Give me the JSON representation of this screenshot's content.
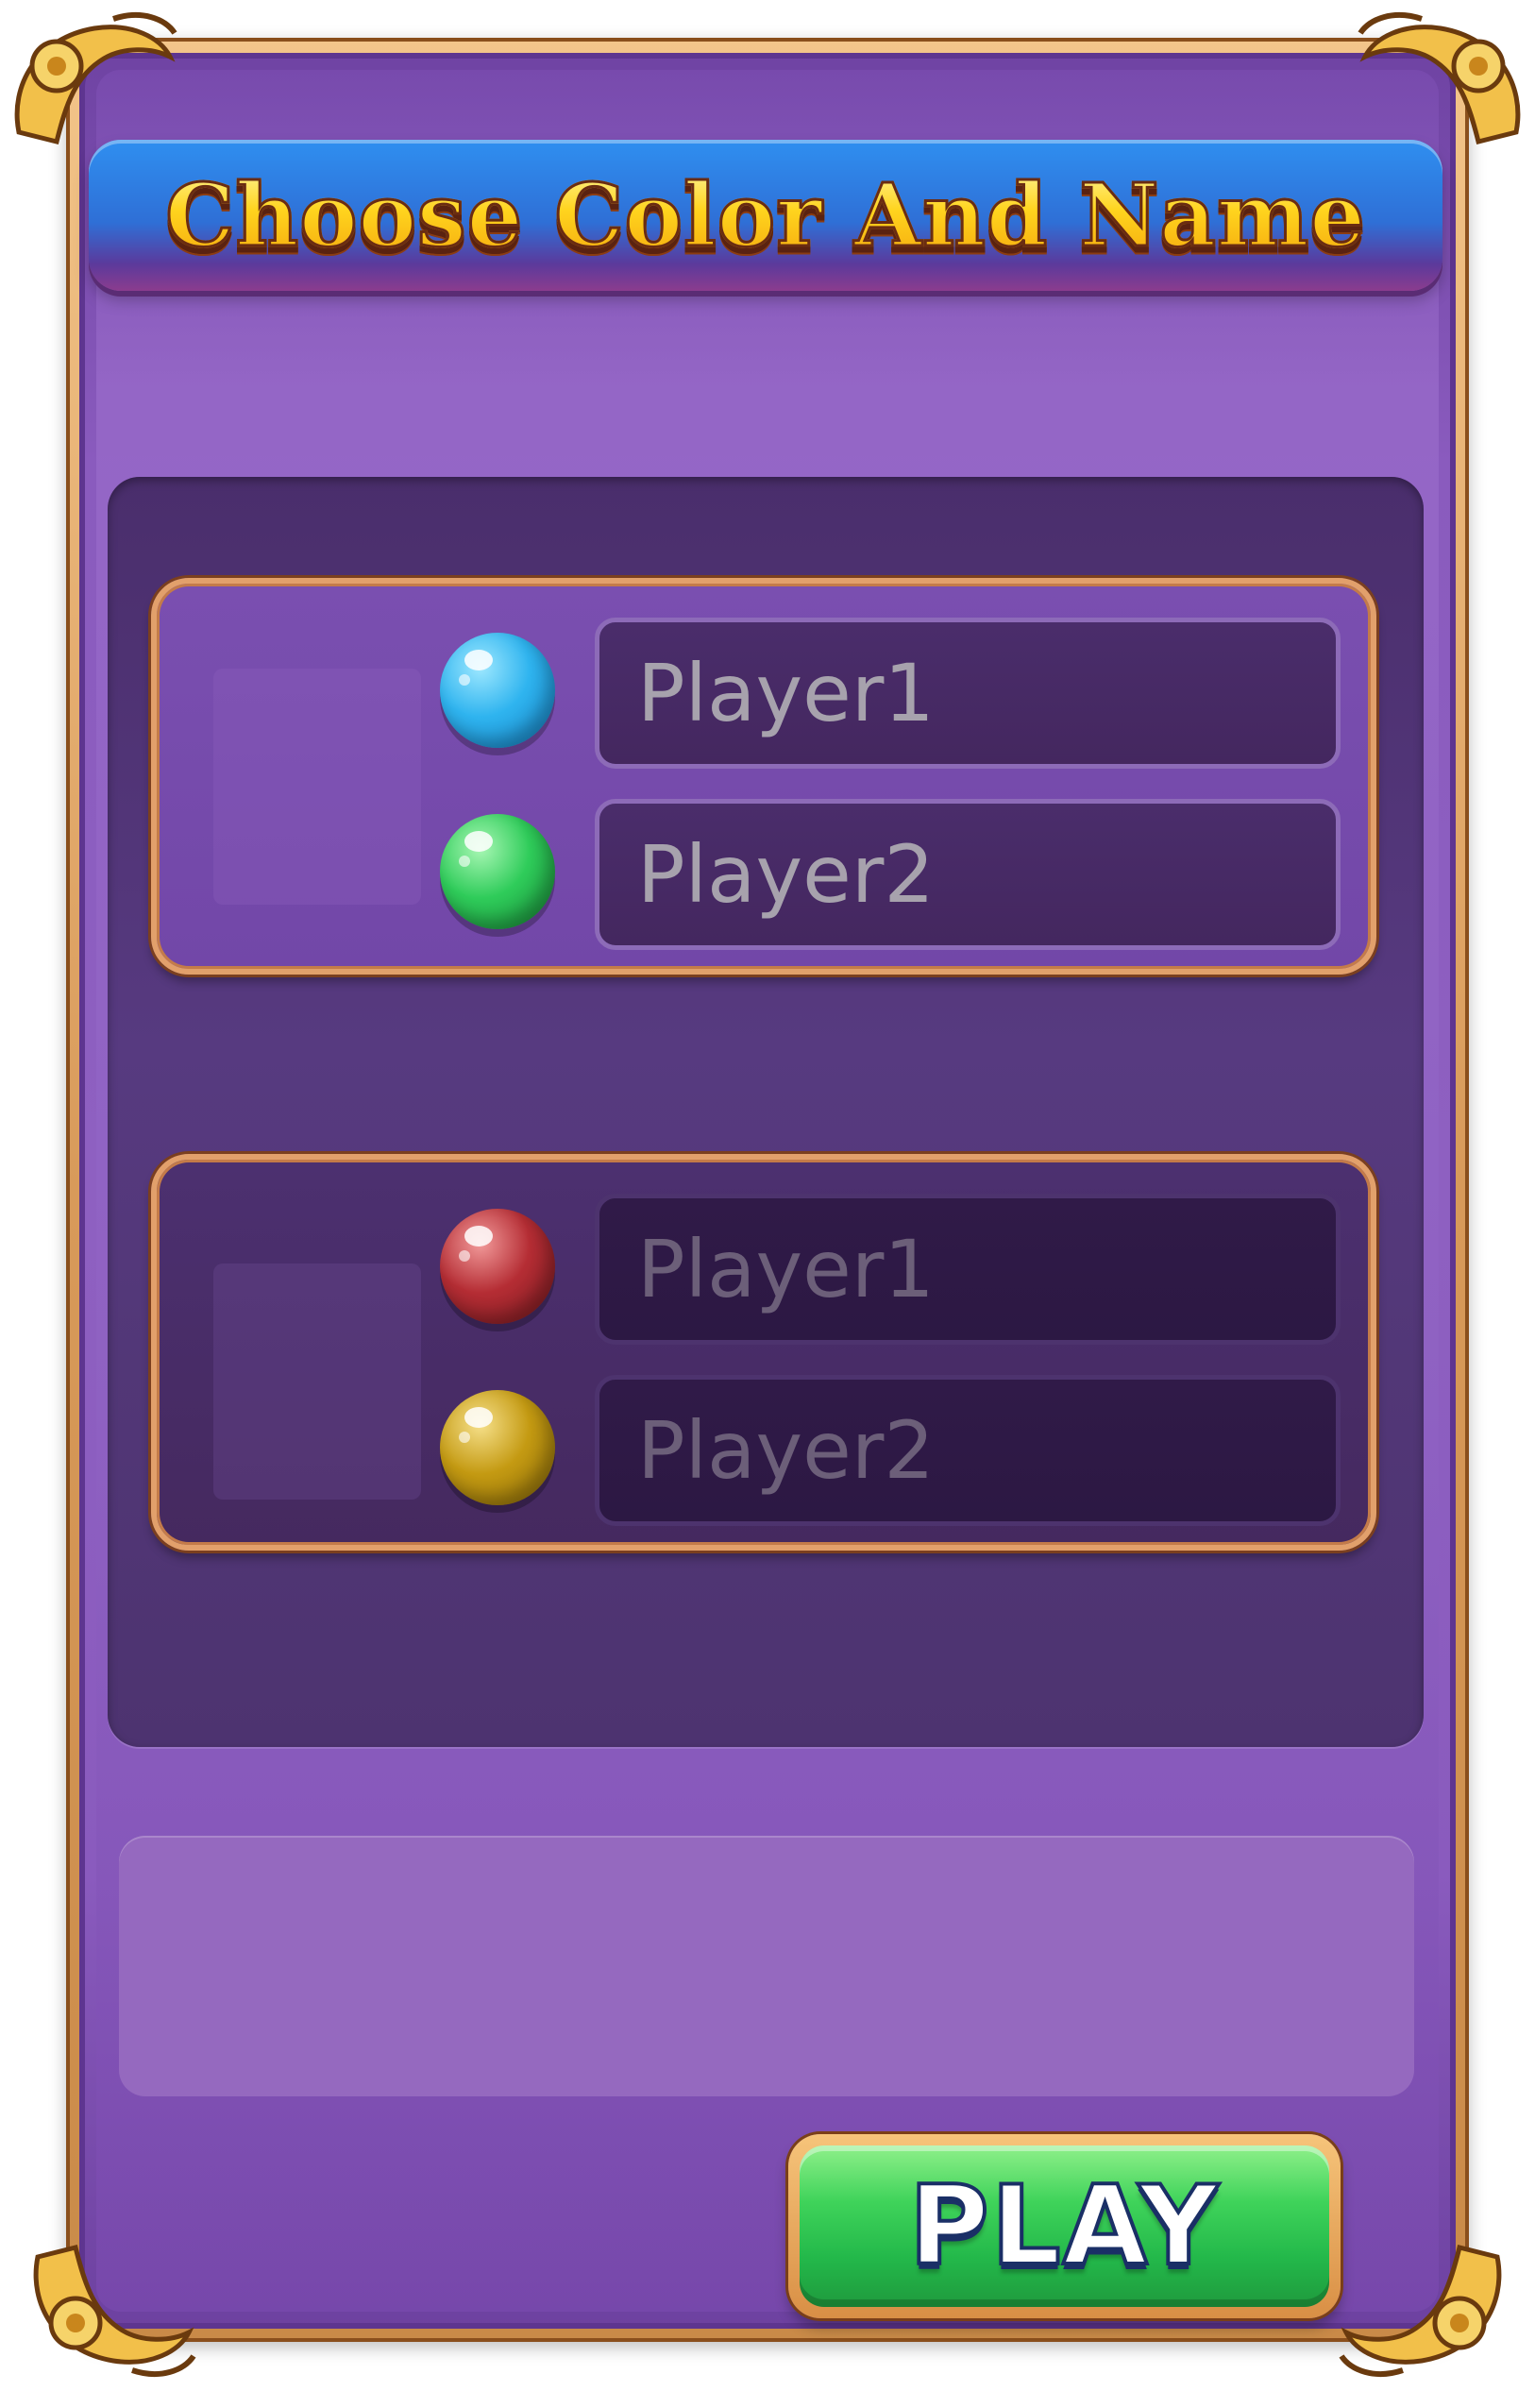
{
  "title": "Choose Color And Name",
  "groups": [
    {
      "players": [
        {
          "name_placeholder": "Player1",
          "ball_color": "#2fb4ef",
          "ball_color_name": "blue"
        },
        {
          "name_placeholder": "Player2",
          "ball_color": "#2fcc5a",
          "ball_color_name": "green"
        }
      ],
      "state": "active"
    },
    {
      "players": [
        {
          "name_placeholder": "Player1",
          "ball_color": "#b52d34",
          "ball_color_name": "red"
        },
        {
          "name_placeholder": "Player2",
          "ball_color": "#c49a12",
          "ball_color_name": "yellow"
        }
      ],
      "state": "inactive"
    }
  ],
  "play_button": {
    "label": "PLAY"
  },
  "colors": {
    "panel": "#8e60c1",
    "well": "#523777",
    "gold": "#e2a06b",
    "play_green": "#23b84a"
  },
  "icons": {
    "corner": "gold-scroll-ornament-icon"
  }
}
